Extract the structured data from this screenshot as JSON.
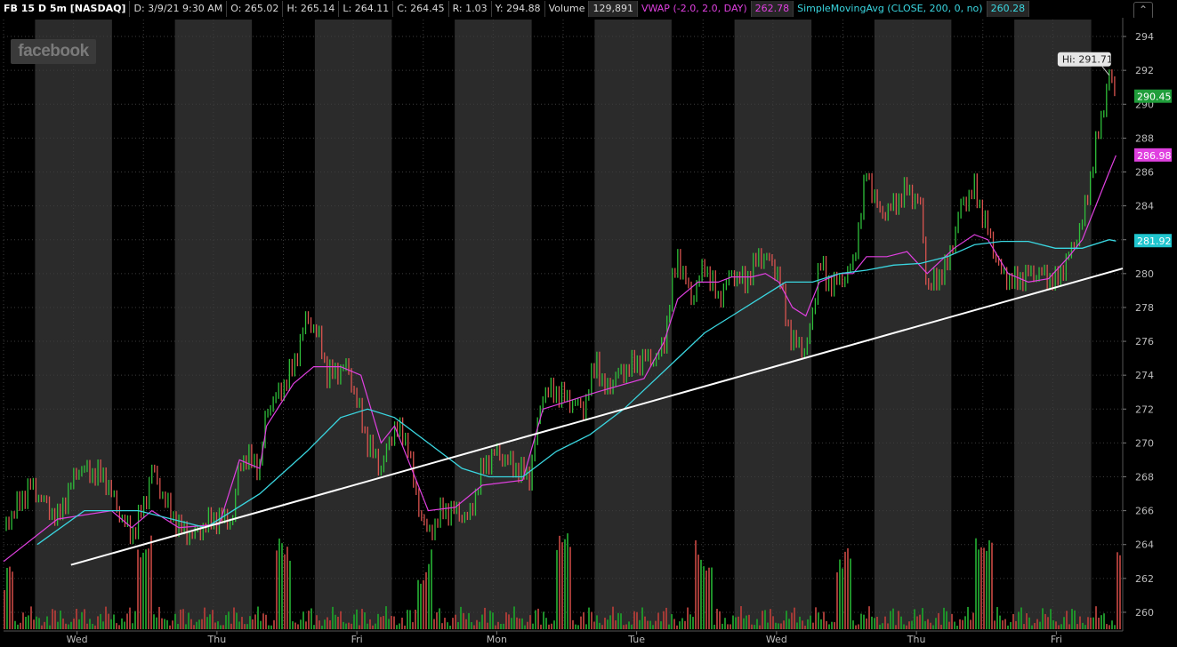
{
  "header": {
    "symbol": "FB 15 D 5m [NASDAQ]",
    "date": "D: 3/9/21 9:30 AM",
    "open": "O: 265.02",
    "high": "H: 265.14",
    "low": "L: 264.11",
    "close": "C: 264.45",
    "range": "R: 1.03",
    "yclose": "Y: 294.88",
    "volume_label": "Volume",
    "volume_value": "129,891",
    "vwap_label": "VWAP (-2.0, 2.0, DAY)",
    "vwap_value": "262.78",
    "sma_label": "SimpleMovingAvg (CLOSE, 200, 0, no)",
    "sma_value": "260.28",
    "collapse_icon": "chevron-up-icon"
  },
  "watermark": "facebook",
  "hi_label": "Hi: 291.71",
  "price_markers": [
    {
      "text": "290.45",
      "color": "#1f9d3a",
      "value": 290.45
    },
    {
      "text": "286.98",
      "color": "#e040e0",
      "value": 286.98
    },
    {
      "text": "281.92",
      "color": "#20c6cf",
      "value": 281.92
    }
  ],
  "colors": {
    "up": "#2fbf3a",
    "down": "#d9534f",
    "vwap": "#e040e0",
    "sma": "#3ad6e0",
    "trendline": "#ffffff",
    "session_band": "#2b2b2b",
    "background": "#000000"
  },
  "chart_data": {
    "type": "line",
    "ylim": [
      259,
      295
    ],
    "yticks": [
      260,
      262,
      264,
      266,
      268,
      270,
      272,
      274,
      276,
      278,
      280,
      282,
      284,
      286,
      288,
      290,
      292,
      294
    ],
    "x_day_labels": [
      "Wed",
      "Thu",
      "Fri",
      "Mon",
      "Tue",
      "Wed",
      "Thu",
      "Fri"
    ],
    "grid": true,
    "series": [
      {
        "name": "Price",
        "points": [
          [
            0,
            265
          ],
          [
            4,
            267.5
          ],
          [
            8,
            265.5
          ],
          [
            11,
            268.5
          ],
          [
            15,
            268
          ],
          [
            17,
            266
          ],
          [
            19,
            264.5
          ],
          [
            21,
            266.5
          ],
          [
            22,
            268.5
          ],
          [
            24,
            266.5
          ],
          [
            26,
            265
          ],
          [
            28,
            264.5
          ],
          [
            31,
            265.5
          ],
          [
            34,
            265.5
          ],
          [
            35,
            269
          ],
          [
            37,
            269
          ],
          [
            38,
            268.5
          ],
          [
            39,
            272
          ],
          [
            41,
            273
          ],
          [
            43,
            274.5
          ],
          [
            45,
            277.5
          ],
          [
            47,
            276
          ],
          [
            48,
            274
          ],
          [
            51,
            274.5
          ],
          [
            52,
            273
          ],
          [
            54,
            270
          ],
          [
            56,
            268.5
          ],
          [
            58,
            271
          ],
          [
            60,
            270
          ],
          [
            61,
            267
          ],
          [
            63,
            264.5
          ],
          [
            65,
            266
          ],
          [
            67,
            266
          ],
          [
            69,
            265.5
          ],
          [
            71,
            268.5
          ],
          [
            73,
            269.5
          ],
          [
            76,
            268.5
          ],
          [
            78,
            268
          ],
          [
            80,
            273
          ],
          [
            82,
            273
          ],
          [
            84,
            272.5
          ],
          [
            86,
            272
          ],
          [
            88,
            275
          ],
          [
            89,
            273
          ],
          [
            91,
            274
          ],
          [
            93,
            274.5
          ],
          [
            95,
            275
          ],
          [
            97,
            275
          ],
          [
            98,
            276
          ],
          [
            99,
            279
          ],
          [
            100,
            281
          ],
          [
            102,
            278.5
          ],
          [
            104,
            280.5
          ],
          [
            106,
            278.5
          ],
          [
            108,
            280
          ],
          [
            110,
            279.5
          ],
          [
            112,
            281
          ],
          [
            113,
            281
          ],
          [
            115,
            280
          ],
          [
            116,
            277.5
          ],
          [
            117,
            276
          ],
          [
            119,
            275.5
          ],
          [
            120,
            277.5
          ],
          [
            121,
            281
          ],
          [
            122,
            279.5
          ],
          [
            124,
            279.5
          ],
          [
            126,
            280.5
          ],
          [
            128,
            286
          ],
          [
            130,
            283.5
          ],
          [
            132,
            284
          ],
          [
            134,
            285
          ],
          [
            136,
            284
          ],
          [
            137,
            279
          ],
          [
            140,
            280.5
          ],
          [
            142,
            284
          ],
          [
            144,
            285
          ],
          [
            146,
            282.5
          ],
          [
            148,
            280
          ],
          [
            150,
            279.5
          ],
          [
            152,
            280
          ],
          [
            154,
            280
          ],
          [
            156,
            279.5
          ],
          [
            158,
            281
          ],
          [
            160,
            283
          ],
          [
            162,
            287.5
          ],
          [
            164,
            291.71
          ],
          [
            165,
            290.45
          ]
        ]
      },
      {
        "name": "VWAP",
        "points": [
          [
            0,
            263
          ],
          [
            8,
            265.5
          ],
          [
            16,
            266
          ],
          [
            19,
            265
          ],
          [
            22,
            266
          ],
          [
            24,
            265.5
          ],
          [
            26,
            265
          ],
          [
            32,
            265.2
          ],
          [
            35,
            269
          ],
          [
            38,
            268.5
          ],
          [
            39,
            271
          ],
          [
            43,
            273.5
          ],
          [
            46,
            274.5
          ],
          [
            50,
            274.5
          ],
          [
            53,
            274
          ],
          [
            56,
            270
          ],
          [
            58,
            271
          ],
          [
            61,
            268
          ],
          [
            63,
            266
          ],
          [
            67,
            266.2
          ],
          [
            71,
            267.5
          ],
          [
            77,
            267.8
          ],
          [
            80,
            272
          ],
          [
            84,
            272.5
          ],
          [
            88,
            273
          ],
          [
            95,
            273.8
          ],
          [
            98,
            276
          ],
          [
            100,
            278.5
          ],
          [
            103,
            279.5
          ],
          [
            106,
            279.5
          ],
          [
            108,
            279.8
          ],
          [
            111,
            279.8
          ],
          [
            113,
            280
          ],
          [
            115,
            279.5
          ],
          [
            117,
            278
          ],
          [
            119,
            277.5
          ],
          [
            121,
            279.5
          ],
          [
            124,
            280
          ],
          [
            126,
            280
          ],
          [
            128,
            281
          ],
          [
            131,
            281
          ],
          [
            134,
            281.3
          ],
          [
            137,
            280
          ],
          [
            141,
            281.5
          ],
          [
            144,
            282.3
          ],
          [
            146,
            282
          ],
          [
            149,
            280
          ],
          [
            152,
            279.5
          ],
          [
            155,
            279.7
          ],
          [
            158,
            281
          ],
          [
            160,
            282
          ],
          [
            162,
            284
          ],
          [
            164,
            286
          ],
          [
            165,
            286.98
          ]
        ]
      },
      {
        "name": "SMA 200",
        "points": [
          [
            5,
            264
          ],
          [
            12,
            266
          ],
          [
            20,
            266
          ],
          [
            30,
            265
          ],
          [
            38,
            267
          ],
          [
            45,
            269.5
          ],
          [
            50,
            271.5
          ],
          [
            54,
            272
          ],
          [
            58,
            271.5
          ],
          [
            63,
            270
          ],
          [
            68,
            268.5
          ],
          [
            72,
            268
          ],
          [
            77,
            268
          ],
          [
            82,
            269.5
          ],
          [
            87,
            270.5
          ],
          [
            92,
            272
          ],
          [
            96,
            273.5
          ],
          [
            100,
            275
          ],
          [
            104,
            276.5
          ],
          [
            108,
            277.5
          ],
          [
            112,
            278.5
          ],
          [
            116,
            279.5
          ],
          [
            120,
            279.5
          ],
          [
            124,
            280
          ],
          [
            128,
            280.2
          ],
          [
            132,
            280.5
          ],
          [
            136,
            280.6
          ],
          [
            140,
            281
          ],
          [
            144,
            281.7
          ],
          [
            148,
            281.9
          ],
          [
            152,
            281.9
          ],
          [
            156,
            281.5
          ],
          [
            160,
            281.5
          ],
          [
            164,
            282
          ],
          [
            165,
            281.92
          ]
        ]
      },
      {
        "name": "Trendline",
        "points": [
          [
            10,
            262.8
          ],
          [
            166,
            280.3
          ]
        ]
      }
    ]
  }
}
